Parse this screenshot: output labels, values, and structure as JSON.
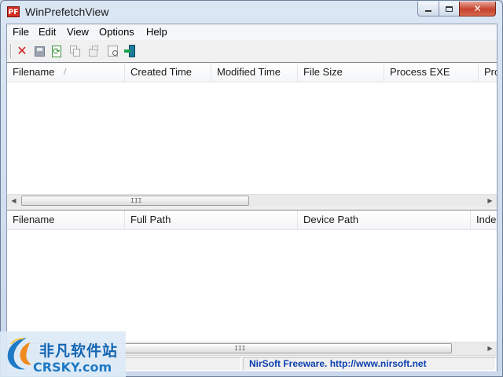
{
  "window": {
    "title": "WinPrefetchView",
    "app_icon_text": "PF",
    "caption_buttons": {
      "minimize": "minimize",
      "maximize": "maximize",
      "close": "✕"
    }
  },
  "menu": [
    "File",
    "Edit",
    "View",
    "Options",
    "Help"
  ],
  "toolbar": {
    "buttons": [
      {
        "name": "delete",
        "icon": "red-x-icon"
      },
      {
        "name": "save",
        "icon": "floppy-disk-icon"
      },
      {
        "name": "refresh",
        "icon": "refresh-icon"
      },
      {
        "name": "copy",
        "icon": "copy-icon"
      },
      {
        "name": "properties",
        "icon": "properties-icon"
      },
      {
        "name": "html-report",
        "icon": "html-report-icon"
      },
      {
        "name": "exit",
        "icon": "exit-door-icon"
      }
    ]
  },
  "upper_list": {
    "columns": [
      "Filename",
      "Created Time",
      "Modified Time",
      "File Size",
      "Process EXE",
      "Pro"
    ],
    "sort_indicator": "/",
    "rows": [],
    "scroll_grip": "III"
  },
  "lower_list": {
    "columns": [
      "Filename",
      "Full Path",
      "Device Path",
      "Inde"
    ],
    "rows": [],
    "scroll_grip": "III"
  },
  "status": {
    "link_text": "NirSoft Freeware.  http://www.nirsoft.net"
  },
  "watermark": {
    "cn": "非凡软件站",
    "en": "CRSKY.com"
  },
  "colors": {
    "status_link": "#0b3fae",
    "close_button": "#c6422c",
    "delete_icon": "#d21c1c",
    "watermark_blue": "#1465b2"
  }
}
